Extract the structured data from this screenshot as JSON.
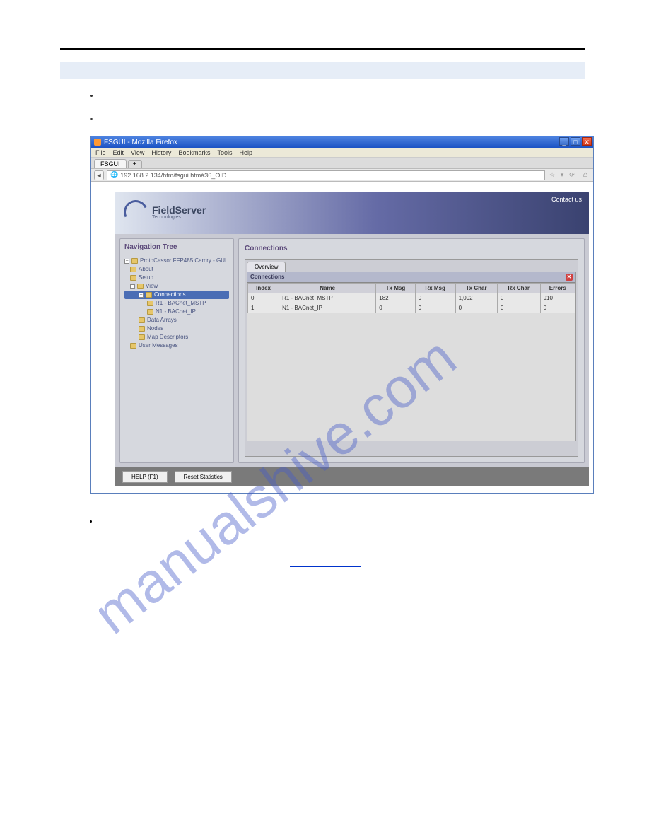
{
  "browser": {
    "title": "FSGUI - Mozilla Firefox",
    "menu": {
      "file": "File",
      "edit": "Edit",
      "view": "View",
      "history": "History",
      "bookmarks": "Bookmarks",
      "tools": "Tools",
      "help": "Help"
    },
    "tab_name": "FSGUI",
    "newtab": "+",
    "url": "192.168.2.134/htm/fsgui.htm#36_OID",
    "nav_back": "◄",
    "star": "☆",
    "dropdown": "▾",
    "reload": "⟳",
    "home": "⌂"
  },
  "header": {
    "logo_bold": "FieldServer",
    "logo_sub": "Technologies",
    "contact": "Contact us"
  },
  "nav": {
    "title": "Navigation Tree",
    "root": "ProtoCessor FFP485 Camry - GUI",
    "items": {
      "about": "About",
      "setup": "Setup",
      "view": "View",
      "connections": "Connections",
      "r1": "R1 - BACnet_MSTP",
      "n1": "N1 - BACnet_IP",
      "data_arrays": "Data Arrays",
      "nodes": "Nodes",
      "map_descriptors": "Map Descriptors",
      "user_messages": "User Messages"
    }
  },
  "main": {
    "title": "Connections",
    "tab_overview": "Overview",
    "section": "Connections",
    "close": "✕",
    "columns": {
      "index": "Index",
      "name": "Name",
      "txmsg": "Tx Msg",
      "rxmsg": "Rx Msg",
      "txchar": "Tx Char",
      "rxchar": "Rx Char",
      "errors": "Errors"
    },
    "rows": [
      {
        "index": "0",
        "name": "R1 - BACnet_MSTP",
        "txmsg": "182",
        "rxmsg": "0",
        "txchar": "1,092",
        "rxchar": "0",
        "errors": "910"
      },
      {
        "index": "1",
        "name": "N1 - BACnet_IP",
        "txmsg": "0",
        "rxmsg": "0",
        "txchar": "0",
        "rxchar": "0",
        "errors": "0"
      }
    ]
  },
  "footer": {
    "help": "HELP (F1)",
    "reset": "Reset Statistics"
  },
  "watermark": "manualshive.com"
}
